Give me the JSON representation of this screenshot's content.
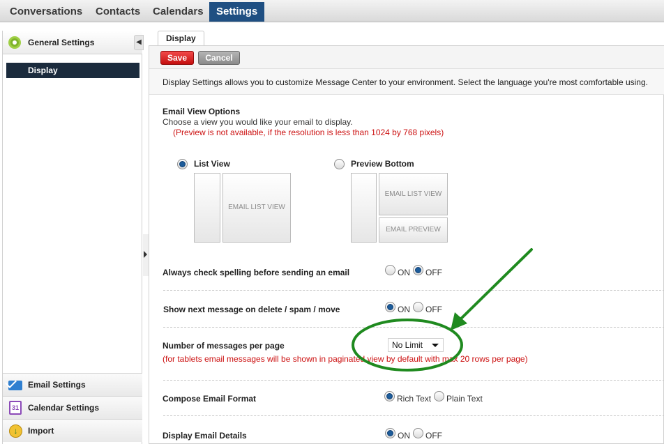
{
  "nav": {
    "tabs": [
      "Conversations",
      "Contacts",
      "Calendars",
      "Settings"
    ],
    "active": "Settings"
  },
  "sidebar": {
    "header": "General Settings",
    "active_item": "Display",
    "bottom_items": [
      "Email Settings",
      "Calendar Settings",
      "Import"
    ],
    "calendar_icon_text": "31"
  },
  "content": {
    "tab_label": "Display",
    "save_label": "Save",
    "cancel_label": "Cancel",
    "description": "Display Settings allows you to customize Message Center to your environment. Select the language you're most comfortable using.",
    "email_view": {
      "title": "Email View Options",
      "subtitle": "Choose a view you would like your email to display.",
      "note": "(Preview is not available, if the resolution is less than 1024 by 768 pixels)",
      "list_view_label": "List View",
      "preview_bottom_label": "Preview Bottom",
      "mock_list": "EMAIL LIST VIEW",
      "mock_preview": "EMAIL PREVIEW",
      "selected": "List View"
    },
    "settings": [
      {
        "label": "Always check spelling before sending an email",
        "options": [
          "ON",
          "OFF"
        ],
        "selected": "OFF"
      },
      {
        "label": "Show next message on delete / spam / move",
        "options": [
          "ON",
          "OFF"
        ],
        "selected": "ON"
      },
      {
        "label": "Number of messages per page",
        "value": "No Limit",
        "note": "(for tablets email messages will be shown in paginated view by default with max 20 rows per page)"
      },
      {
        "label": "Compose Email Format",
        "options": [
          "Rich Text",
          "Plain Text"
        ],
        "selected": "Rich Text"
      },
      {
        "label": "Display Email Details",
        "options": [
          "ON",
          "OFF"
        ],
        "selected": "ON"
      }
    ]
  },
  "annotation_color": "#1f8a1f"
}
